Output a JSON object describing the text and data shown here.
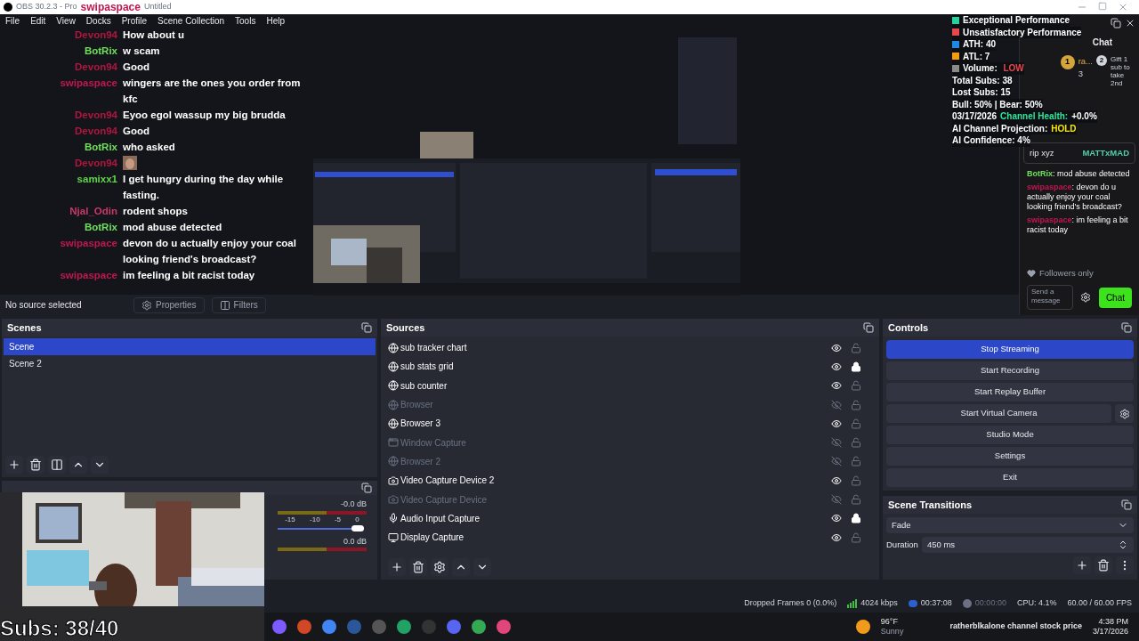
{
  "window": {
    "title_start": "OBS 30.2.3 - Pro",
    "title_overlay": "swipaspace",
    "title_end": "Untitled"
  },
  "menu": [
    "File",
    "Edit",
    "View",
    "Docks",
    "Profile",
    "Scene Collection",
    "Tools",
    "Help"
  ],
  "chat_overlay": [
    {
      "user": "Devon94",
      "color": "#b0163f",
      "kind": "text",
      "text": "How about u"
    },
    {
      "user": "BotRix",
      "color": "#6ee05a",
      "kind": "text",
      "text": "w scam"
    },
    {
      "user": "Devon94",
      "color": "#b0163f",
      "kind": "text",
      "text": "Good"
    },
    {
      "user": "swipaspace",
      "color": "#c0174f",
      "kind": "text",
      "text": "wingers are the ones you order from kfc"
    },
    {
      "user": "Devon94",
      "color": "#b0163f",
      "kind": "text",
      "text": "Eyoo egol wassup my big brudda"
    },
    {
      "user": "Devon94",
      "color": "#b0163f",
      "kind": "text",
      "text": "Good"
    },
    {
      "user": "BotRix",
      "color": "#6ee05a",
      "kind": "text",
      "text": "who asked"
    },
    {
      "user": "Devon94",
      "color": "#b0163f",
      "kind": "emote"
    },
    {
      "user": "samixx1",
      "color": "#5fd64a",
      "kind": "text",
      "text": "I get hungry during the day while fasting."
    },
    {
      "user": "Njal_Odin",
      "color": "#c8386a",
      "kind": "text",
      "text": "rodent shops"
    },
    {
      "user": "BotRix",
      "color": "#6ee05a",
      "kind": "text",
      "text": "mod abuse detected"
    },
    {
      "user": "swipaspace",
      "color": "#c0174f",
      "kind": "text",
      "text": "devon do u actually enjoy your coal looking friend's broadcast?"
    },
    {
      "user": "swipaspace",
      "color": "#c0174f",
      "kind": "text",
      "text": "im feeling a bit racist today"
    }
  ],
  "stats_overlay": {
    "legend": [
      {
        "label": "Exceptional Performance",
        "color": "#22d39a"
      },
      {
        "label": "Unsatisfactory Performance",
        "color": "#e5484d"
      },
      {
        "label": "ATH: 40",
        "color": "#1e88e5"
      },
      {
        "label": "ATL: 7",
        "color": "#f59e0b"
      },
      {
        "label": "Volume: ",
        "value": "LOW",
        "color": "#8a8a8a"
      }
    ],
    "lines": [
      [
        {
          "text": "Total Subs: 38",
          "color": "#ffffff"
        }
      ],
      [
        {
          "text": "Lost Subs: 15",
          "color": "#ffffff"
        }
      ],
      [
        {
          "text": "Bull: 50% | Bear: 50%",
          "color": "#ffffff"
        }
      ],
      [
        {
          "text": "03/17/2026",
          "color": "#ffffff"
        },
        {
          "text": "Channel Health:",
          "color": "#2ee59d"
        },
        {
          "text": "+0.0%",
          "color": "#ffffff"
        }
      ],
      [
        {
          "text": "AI Channel Projection:",
          "color": "#ffffff"
        },
        {
          "text": "HOLD",
          "color": "#f5e60a"
        }
      ],
      [
        {
          "text": "AI Confidence: 4%",
          "color": "#ffffff"
        }
      ]
    ]
  },
  "subs_overlay": "Subs: 38/40",
  "chat_dock": {
    "title": "Chat",
    "leader": {
      "rank": "1",
      "name": "ra...",
      "count": "3",
      "next_rank": "2",
      "gift": "Gift 1 sub to take 2nd"
    },
    "pinned": {
      "user": "MATTxMAD",
      "text": "rip xyz"
    },
    "messages": [
      {
        "user": "BotRix",
        "color": "#6ee05a",
        "sep": ":",
        "text": "mod abuse detected"
      },
      {
        "user": "swipaspace",
        "color": "#c0174f",
        "sep": ":",
        "text": "devon do u actually enjoy your coal looking friend's broadcast?"
      },
      {
        "user": "swipaspace",
        "color": "#c0174f",
        "sep": ":",
        "text": "im feeling a bit racist today"
      }
    ],
    "mode": "Followers only",
    "placeholder": "Send a message",
    "send": "Chat"
  },
  "source_toolbar": {
    "status": "No source selected",
    "properties": "Properties",
    "filters": "Filters"
  },
  "scenes": {
    "title": "Scenes",
    "items": [
      {
        "name": "Scene",
        "selected": true
      },
      {
        "name": "Scene 2",
        "selected": false
      }
    ]
  },
  "mixer": {
    "channels": [
      {
        "reading": "-0.0 dB",
        "level": 0.97
      },
      {
        "reading": "0.0 dB"
      }
    ],
    "ticks": [
      "-15",
      "-10",
      "-5",
      "0"
    ]
  },
  "sources": {
    "title": "Sources",
    "items": [
      {
        "name": "sub tracker chart",
        "kind": "browser",
        "visible": true,
        "locked": false
      },
      {
        "name": "sub stats grid",
        "kind": "browser",
        "visible": true,
        "locked": true
      },
      {
        "name": "sub counter",
        "kind": "browser",
        "visible": true,
        "locked": false
      },
      {
        "name": "Browser",
        "kind": "browser",
        "visible": false,
        "locked": false
      },
      {
        "name": "Browser 3",
        "kind": "browser",
        "visible": true,
        "locked": false
      },
      {
        "name": "Window Capture",
        "kind": "window",
        "visible": false,
        "locked": false
      },
      {
        "name": "Browser 2",
        "kind": "browser",
        "visible": false,
        "locked": false
      },
      {
        "name": "Video Capture Device 2",
        "kind": "camera",
        "visible": true,
        "locked": false
      },
      {
        "name": "Video Capture Device",
        "kind": "camera",
        "visible": false,
        "locked": false
      },
      {
        "name": "Audio Input Capture",
        "kind": "mic",
        "visible": true,
        "locked": true
      },
      {
        "name": "Display Capture",
        "kind": "display",
        "visible": true,
        "locked": false
      }
    ]
  },
  "controls": {
    "title": "Controls",
    "buttons": [
      {
        "label": "Stop Streaming",
        "active": true
      },
      {
        "label": "Start Recording",
        "active": false
      },
      {
        "label": "Start Replay Buffer",
        "active": false
      },
      {
        "label": "Start Virtual Camera",
        "active": false,
        "kind": "with_settings"
      },
      {
        "label": "Studio Mode",
        "active": false
      },
      {
        "label": "Settings",
        "active": false
      },
      {
        "label": "Exit",
        "active": false
      }
    ]
  },
  "transitions": {
    "title": "Scene Transitions",
    "type": "Fade",
    "duration_label": "Duration",
    "duration": "450 ms"
  },
  "status_bar": {
    "dropped": "Dropped Frames 0 (0.0%)",
    "bitrate": "4024 kbps",
    "stream_time": "00:37:08",
    "record_time": "00:00:00",
    "cpu": "CPU: 4.1%",
    "fps": "60.00 / 60.00 FPS"
  },
  "taskbar": {
    "temperature": "96°F",
    "weather": "Sunny",
    "overlay_text": "ratherblkalone channel stock price",
    "time": "4:38 PM",
    "date": "3/17/2026"
  }
}
